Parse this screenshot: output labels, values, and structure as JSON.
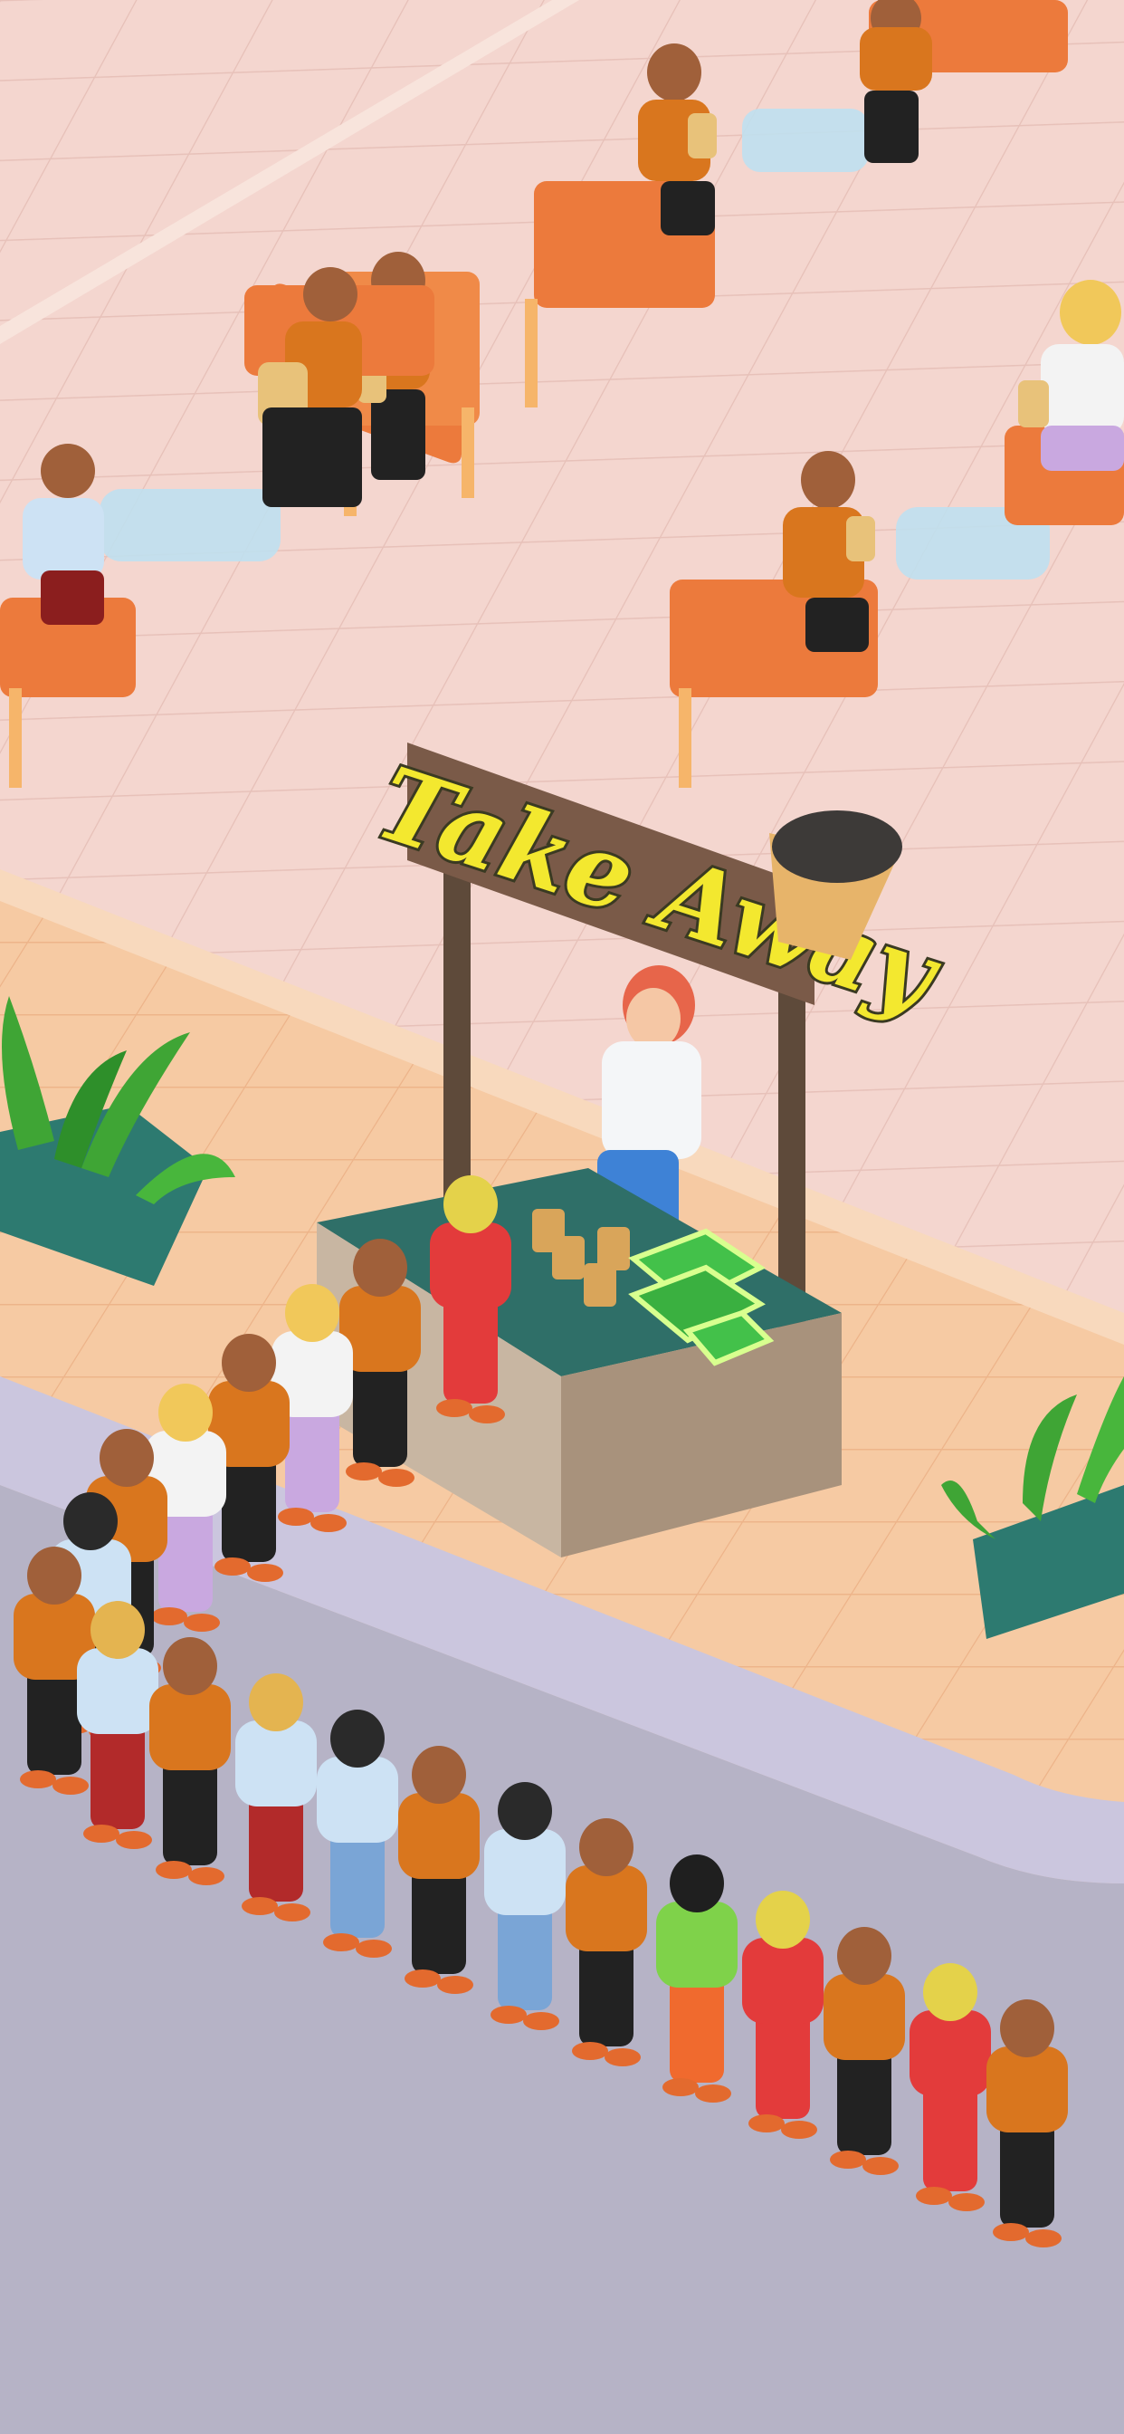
{
  "game": {
    "sign": {
      "title": "Take Away"
    },
    "colors": {
      "floor_pink": "#f4d6cf",
      "floor_tile_line": "#e9c0b8",
      "sidewalk_peach": "#f5c9a3",
      "sidewalk_tile_line": "#efb88d",
      "curb": "#c9c5dc",
      "road": "#b7b4c7",
      "sign_board": "#7a5a48",
      "sign_text": "#f3e82f",
      "sign_text_outline": "#3a3a22",
      "counter_teal": "#2f6f68",
      "counter_wood": "#c8b6a2",
      "planter_teal": "#2d7a70",
      "plant_green": "#3fa535",
      "chair_orange": "#ec7a3c",
      "chair_frame": "#f6b56a",
      "table_glass": "#bfe0ef",
      "shirt_orange": "#d9761e",
      "money_green": "#43c14a"
    },
    "icons": {
      "coffee_cup": "coffee-cup-icon",
      "cash_stack": "cash-stack-icon"
    }
  }
}
